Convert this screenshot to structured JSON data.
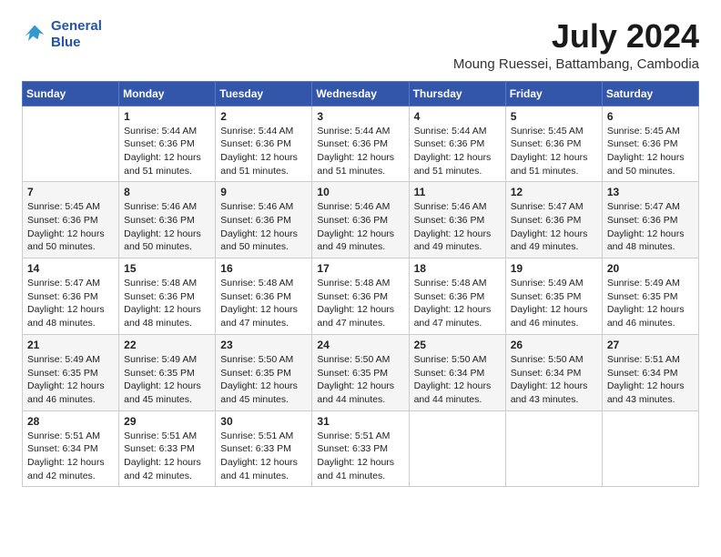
{
  "logo": {
    "line1": "General",
    "line2": "Blue"
  },
  "title": "July 2024",
  "subtitle": "Moung Ruessei, Battambang, Cambodia",
  "days_header": [
    "Sunday",
    "Monday",
    "Tuesday",
    "Wednesday",
    "Thursday",
    "Friday",
    "Saturday"
  ],
  "weeks": [
    [
      {
        "day": "",
        "sunrise": "",
        "sunset": "",
        "daylight": ""
      },
      {
        "day": "1",
        "sunrise": "Sunrise: 5:44 AM",
        "sunset": "Sunset: 6:36 PM",
        "daylight": "Daylight: 12 hours and 51 minutes."
      },
      {
        "day": "2",
        "sunrise": "Sunrise: 5:44 AM",
        "sunset": "Sunset: 6:36 PM",
        "daylight": "Daylight: 12 hours and 51 minutes."
      },
      {
        "day": "3",
        "sunrise": "Sunrise: 5:44 AM",
        "sunset": "Sunset: 6:36 PM",
        "daylight": "Daylight: 12 hours and 51 minutes."
      },
      {
        "day": "4",
        "sunrise": "Sunrise: 5:44 AM",
        "sunset": "Sunset: 6:36 PM",
        "daylight": "Daylight: 12 hours and 51 minutes."
      },
      {
        "day": "5",
        "sunrise": "Sunrise: 5:45 AM",
        "sunset": "Sunset: 6:36 PM",
        "daylight": "Daylight: 12 hours and 51 minutes."
      },
      {
        "day": "6",
        "sunrise": "Sunrise: 5:45 AM",
        "sunset": "Sunset: 6:36 PM",
        "daylight": "Daylight: 12 hours and 50 minutes."
      }
    ],
    [
      {
        "day": "7",
        "sunrise": "Sunrise: 5:45 AM",
        "sunset": "Sunset: 6:36 PM",
        "daylight": "Daylight: 12 hours and 50 minutes."
      },
      {
        "day": "8",
        "sunrise": "Sunrise: 5:46 AM",
        "sunset": "Sunset: 6:36 PM",
        "daylight": "Daylight: 12 hours and 50 minutes."
      },
      {
        "day": "9",
        "sunrise": "Sunrise: 5:46 AM",
        "sunset": "Sunset: 6:36 PM",
        "daylight": "Daylight: 12 hours and 50 minutes."
      },
      {
        "day": "10",
        "sunrise": "Sunrise: 5:46 AM",
        "sunset": "Sunset: 6:36 PM",
        "daylight": "Daylight: 12 hours and 49 minutes."
      },
      {
        "day": "11",
        "sunrise": "Sunrise: 5:46 AM",
        "sunset": "Sunset: 6:36 PM",
        "daylight": "Daylight: 12 hours and 49 minutes."
      },
      {
        "day": "12",
        "sunrise": "Sunrise: 5:47 AM",
        "sunset": "Sunset: 6:36 PM",
        "daylight": "Daylight: 12 hours and 49 minutes."
      },
      {
        "day": "13",
        "sunrise": "Sunrise: 5:47 AM",
        "sunset": "Sunset: 6:36 PM",
        "daylight": "Daylight: 12 hours and 48 minutes."
      }
    ],
    [
      {
        "day": "14",
        "sunrise": "Sunrise: 5:47 AM",
        "sunset": "Sunset: 6:36 PM",
        "daylight": "Daylight: 12 hours and 48 minutes."
      },
      {
        "day": "15",
        "sunrise": "Sunrise: 5:48 AM",
        "sunset": "Sunset: 6:36 PM",
        "daylight": "Daylight: 12 hours and 48 minutes."
      },
      {
        "day": "16",
        "sunrise": "Sunrise: 5:48 AM",
        "sunset": "Sunset: 6:36 PM",
        "daylight": "Daylight: 12 hours and 47 minutes."
      },
      {
        "day": "17",
        "sunrise": "Sunrise: 5:48 AM",
        "sunset": "Sunset: 6:36 PM",
        "daylight": "Daylight: 12 hours and 47 minutes."
      },
      {
        "day": "18",
        "sunrise": "Sunrise: 5:48 AM",
        "sunset": "Sunset: 6:36 PM",
        "daylight": "Daylight: 12 hours and 47 minutes."
      },
      {
        "day": "19",
        "sunrise": "Sunrise: 5:49 AM",
        "sunset": "Sunset: 6:35 PM",
        "daylight": "Daylight: 12 hours and 46 minutes."
      },
      {
        "day": "20",
        "sunrise": "Sunrise: 5:49 AM",
        "sunset": "Sunset: 6:35 PM",
        "daylight": "Daylight: 12 hours and 46 minutes."
      }
    ],
    [
      {
        "day": "21",
        "sunrise": "Sunrise: 5:49 AM",
        "sunset": "Sunset: 6:35 PM",
        "daylight": "Daylight: 12 hours and 46 minutes."
      },
      {
        "day": "22",
        "sunrise": "Sunrise: 5:49 AM",
        "sunset": "Sunset: 6:35 PM",
        "daylight": "Daylight: 12 hours and 45 minutes."
      },
      {
        "day": "23",
        "sunrise": "Sunrise: 5:50 AM",
        "sunset": "Sunset: 6:35 PM",
        "daylight": "Daylight: 12 hours and 45 minutes."
      },
      {
        "day": "24",
        "sunrise": "Sunrise: 5:50 AM",
        "sunset": "Sunset: 6:35 PM",
        "daylight": "Daylight: 12 hours and 44 minutes."
      },
      {
        "day": "25",
        "sunrise": "Sunrise: 5:50 AM",
        "sunset": "Sunset: 6:34 PM",
        "daylight": "Daylight: 12 hours and 44 minutes."
      },
      {
        "day": "26",
        "sunrise": "Sunrise: 5:50 AM",
        "sunset": "Sunset: 6:34 PM",
        "daylight": "Daylight: 12 hours and 43 minutes."
      },
      {
        "day": "27",
        "sunrise": "Sunrise: 5:51 AM",
        "sunset": "Sunset: 6:34 PM",
        "daylight": "Daylight: 12 hours and 43 minutes."
      }
    ],
    [
      {
        "day": "28",
        "sunrise": "Sunrise: 5:51 AM",
        "sunset": "Sunset: 6:34 PM",
        "daylight": "Daylight: 12 hours and 42 minutes."
      },
      {
        "day": "29",
        "sunrise": "Sunrise: 5:51 AM",
        "sunset": "Sunset: 6:33 PM",
        "daylight": "Daylight: 12 hours and 42 minutes."
      },
      {
        "day": "30",
        "sunrise": "Sunrise: 5:51 AM",
        "sunset": "Sunset: 6:33 PM",
        "daylight": "Daylight: 12 hours and 41 minutes."
      },
      {
        "day": "31",
        "sunrise": "Sunrise: 5:51 AM",
        "sunset": "Sunset: 6:33 PM",
        "daylight": "Daylight: 12 hours and 41 minutes."
      },
      {
        "day": "",
        "sunrise": "",
        "sunset": "",
        "daylight": ""
      },
      {
        "day": "",
        "sunrise": "",
        "sunset": "",
        "daylight": ""
      },
      {
        "day": "",
        "sunrise": "",
        "sunset": "",
        "daylight": ""
      }
    ]
  ]
}
